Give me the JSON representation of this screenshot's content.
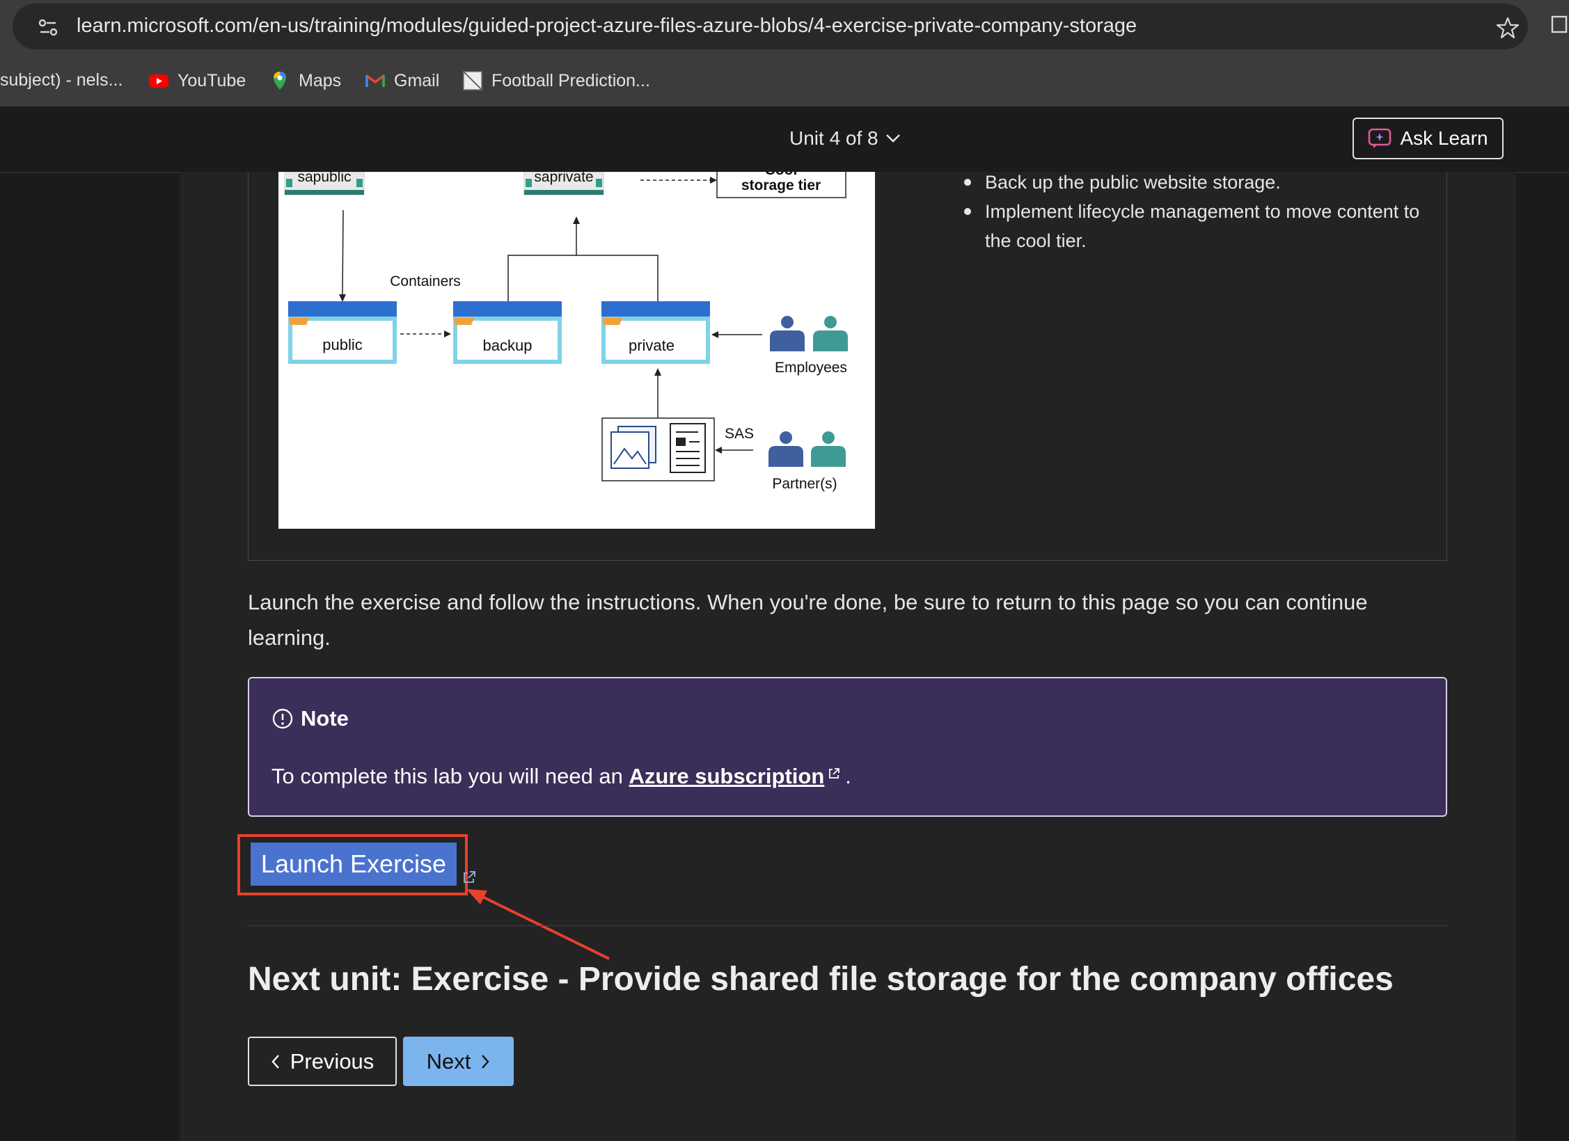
{
  "browser": {
    "url": "learn.microsoft.com/en-us/training/modules/guided-project-azure-files-azure-blobs/4-exercise-private-company-storage",
    "bookmarks": [
      {
        "label": "subject) - nels...",
        "icon": "document-icon"
      },
      {
        "label": "YouTube",
        "icon": "youtube-icon"
      },
      {
        "label": "Maps",
        "icon": "maps-pin-icon"
      },
      {
        "label": "Gmail",
        "icon": "gmail-icon"
      },
      {
        "label": "Football Prediction...",
        "icon": "page-thumbnail-icon"
      }
    ]
  },
  "header": {
    "unit_label": "Unit 4 of 8",
    "ask_learn": "Ask Learn"
  },
  "diagram": {
    "labels": {
      "sapublic": "sapublic",
      "saprivate": "saprivate",
      "cool_top": "Cool",
      "cool_storage_tier": "storage tier",
      "containers": "Containers",
      "public": "public",
      "backup": "backup",
      "private": "private",
      "employees": "Employees",
      "sas": "SAS",
      "partners": "Partner(s)"
    }
  },
  "bullets": [
    "Back up the public website storage.",
    "Implement lifecycle management to move content to the cool tier."
  ],
  "intro": "Launch the exercise and follow the instructions. When you're done, be sure to return to this page so you can continue learning.",
  "note": {
    "title": "Note",
    "body_prefix": "To complete this lab you will need an ",
    "link_text": "Azure subscription",
    "body_suffix": "."
  },
  "launch_button": "Launch Exercise",
  "next_unit_title": "Next unit: Exercise - Provide shared file storage for the company offices",
  "nav": {
    "previous": "Previous",
    "next": "Next"
  },
  "colors": {
    "background": "#1b1b1b",
    "note_background": "#3b2e58",
    "launch_button": "#4a73cf",
    "next_button": "#7cb4ee",
    "highlight": "#e8412c"
  }
}
